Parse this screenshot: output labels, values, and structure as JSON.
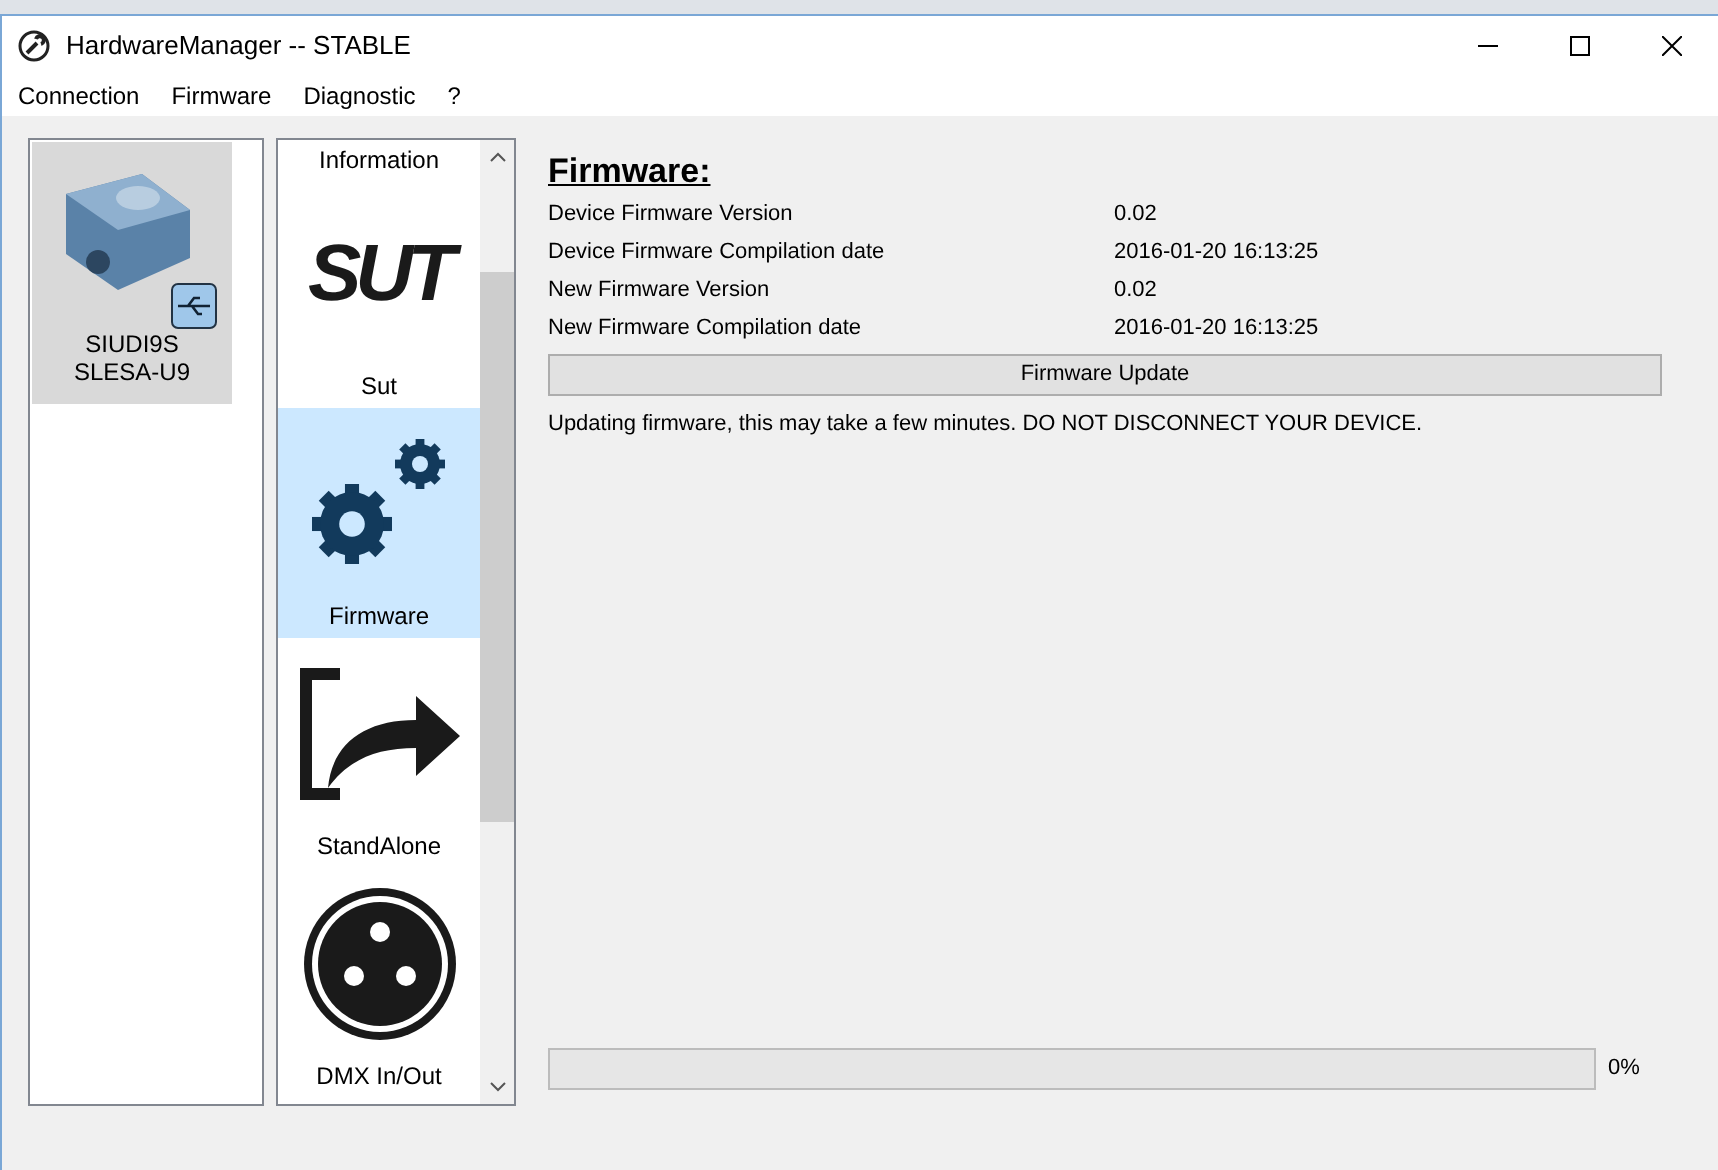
{
  "window": {
    "title": "HardwareManager -- STABLE"
  },
  "menu": [
    "Connection",
    "Firmware",
    "Diagnostic",
    "?"
  ],
  "devices": [
    {
      "line1": "SIUDI9S",
      "line2": "SLESA-U9",
      "selected": true
    }
  ],
  "nav": [
    {
      "kind": "label-only",
      "label": "Information",
      "selected": false
    },
    {
      "kind": "sut",
      "logo": "SUT",
      "label": "Sut",
      "selected": false
    },
    {
      "kind": "gears",
      "label": "Firmware",
      "selected": true
    },
    {
      "kind": "export",
      "label": "StandAlone",
      "selected": false
    },
    {
      "kind": "xlr",
      "label": "DMX In/Out",
      "selected": false
    }
  ],
  "firmware": {
    "heading": "Firmware:",
    "rows": [
      {
        "label": "Device Firmware Version",
        "value": "0.02"
      },
      {
        "label": "Device Firmware Compilation date",
        "value": "2016-01-20 16:13:25"
      },
      {
        "label": "New Firmware Version",
        "value": "0.02"
      },
      {
        "label": "New Firmware Compilation date",
        "value": "2016-01-20 16:13:25"
      }
    ],
    "button": "Firmware Update",
    "notice": "Updating firmware, this may take a few minutes. DO NOT DISCONNECT YOUR DEVICE.",
    "progress": {
      "level": 0,
      "reading": "0%"
    }
  }
}
